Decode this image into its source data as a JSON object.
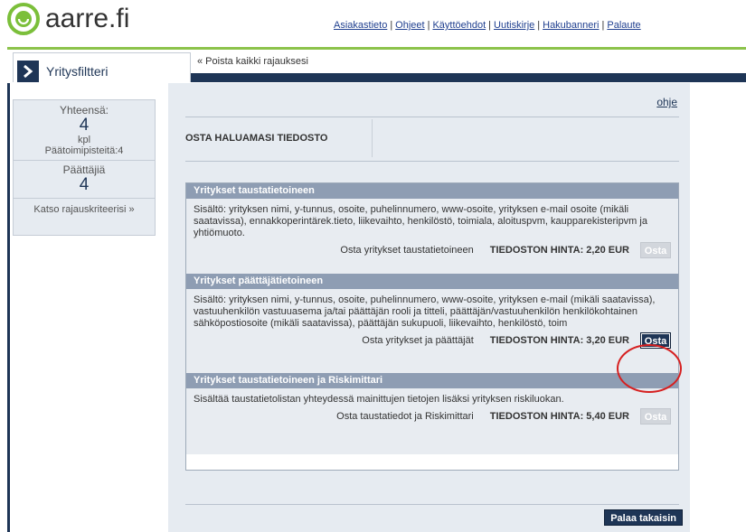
{
  "brand": {
    "name": "aarre.fi",
    "accent": "#7bbf3a",
    "navy": "#1e3556"
  },
  "top_links": [
    "Asiakastieto",
    "Ohjeet",
    "Käyttöehdot",
    "Uutiskirje",
    "Hakubanneri",
    "Palaute"
  ],
  "tab": {
    "label": "Yritysfiltteri",
    "icon": "chevron-right-icon"
  },
  "remove_filters": "« Poista kaikki rajauksesi",
  "sidebar": {
    "total_label": "Yhteensä:",
    "total_value": "4",
    "total_unit": "kpl",
    "offices": "Päätoimipisteitä:4",
    "deciders_label": "Päättäjiä",
    "deciders_value": "4",
    "criteria_link": "Katso rajauskriteerisi »"
  },
  "main": {
    "help": "ohje",
    "section_title": "OSTA HALUAMASI TIEDOSTO",
    "products": [
      {
        "title": "Yritykset taustatietoineen",
        "description": "Sisältö: yrityksen nimi, y-tunnus, osoite, puhelinnumero, www-osoite, yrityksen e-mail osoite (mikäli saatavissa), ennakkoperintärek.tieto, liikevaihto, henkilöstö, toimiala, aloituspvm, kaupparekisteripvm ja yhtiömuoto.",
        "buy_text": "Osta yritykset taustatietoineen",
        "price": "TIEDOSTON HINTA: 2,20 EUR",
        "button": "Osta",
        "enabled": false
      },
      {
        "title": "Yritykset päättäjätietoineen",
        "description": "Sisältö: yrityksen nimi, y-tunnus, osoite, puhelinnumero, www-osoite, yrityksen e-mail (mikäli saatavissa), vastuuhenkilön vastuuasema ja/tai päättäjän rooli ja titteli, päättäjän/vastuuhenkilön henkilökohtainen sähköpostiosoite (mikäli saatavissa), päättäjän sukupuoli, liikevaihto, henkilöstö, toim",
        "buy_text": "Osta yritykset ja päättäjät",
        "price": "TIEDOSTON HINTA: 3,20 EUR",
        "button": "Osta",
        "enabled": true
      },
      {
        "title": "Yritykset taustatietoineen ja Riskimittari",
        "description": "Sisältää taustatietolistan yhteydessä mainittujen tietojen lisäksi yrityksen riskiluokan.",
        "buy_text": "Osta taustatiedot ja Riskimittari",
        "price": "TIEDOSTON HINTA: 5,40 EUR",
        "button": "Osta",
        "enabled": false
      }
    ],
    "back_button": "Palaa takaisin"
  }
}
